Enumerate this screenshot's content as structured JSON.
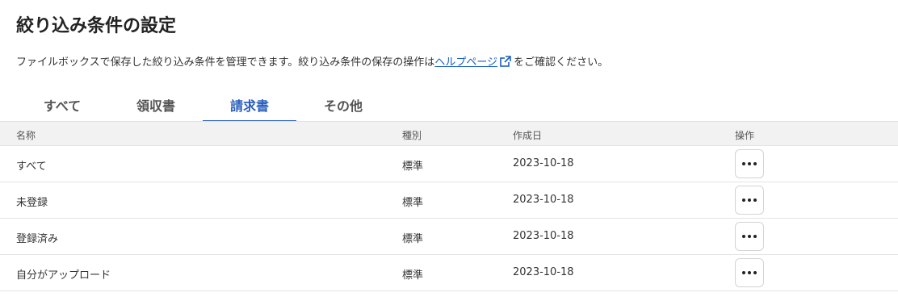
{
  "page": {
    "title": "絞り込み条件の設定",
    "description_before": "ファイルボックスで保存した絞り込み条件を管理できます。絞り込み条件の保存の操作は",
    "help_link": "ヘルプページ",
    "description_after": "をご確認ください。"
  },
  "tabs": [
    {
      "label": "すべて",
      "active": false
    },
    {
      "label": "領収書",
      "active": false
    },
    {
      "label": "請求書",
      "active": true
    },
    {
      "label": "その他",
      "active": false
    }
  ],
  "table": {
    "headers": {
      "name": "名称",
      "type": "種別",
      "created": "作成日",
      "ops": "操作"
    },
    "rows": [
      {
        "name": "すべて",
        "type": "標準",
        "created": "2023-10-18"
      },
      {
        "name": "未登録",
        "type": "標準",
        "created": "2023-10-18"
      },
      {
        "name": "登録済み",
        "type": "標準",
        "created": "2023-10-18"
      },
      {
        "name": "自分がアップロード",
        "type": "標準",
        "created": "2023-10-18"
      }
    ]
  },
  "colors": {
    "accent": "#2b5fbf",
    "link": "#1a5fc4"
  },
  "icons": {
    "help_link": "external-link-icon",
    "row_action": "more-horizontal-icon"
  }
}
